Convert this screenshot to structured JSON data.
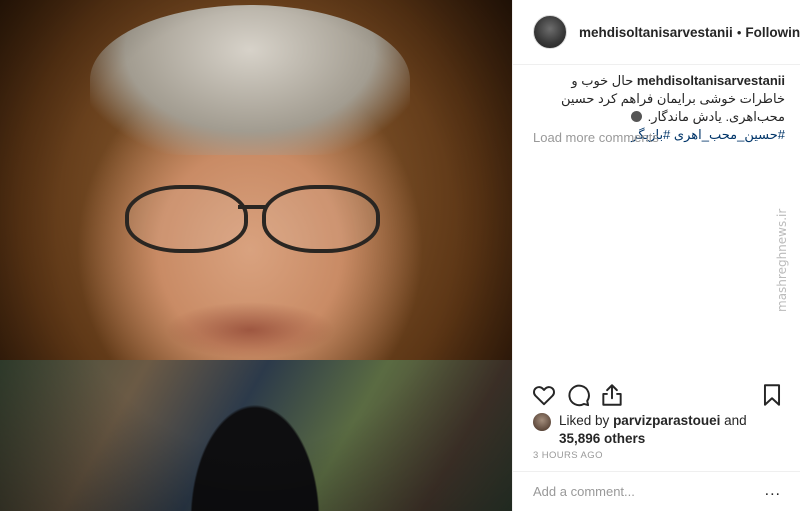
{
  "post": {
    "username": "mehdisoltanisarvestanii",
    "separator": "•",
    "follow_state": "Following"
  },
  "caption": {
    "username": "mehdisoltanisarvestanii",
    "text_1": "حال خوب و خاطرات خوشی برایمان فراهم کرد حسین محب‌اهری. یادش ماندگار.",
    "hashtag_1": "#حسین_محب_اهری",
    "hashtag_2": "#بازیگر"
  },
  "comments": {
    "load_more": "Load more comments"
  },
  "likes": {
    "prefix": "Liked by",
    "liker": "parvizparastouei",
    "and": "and",
    "count": "35,896 others"
  },
  "timestamp": "3 HOURS AGO",
  "add_comment": {
    "placeholder": "Add a comment...",
    "more": "..."
  },
  "icons": {
    "like": "heart-icon",
    "comment": "comment-icon",
    "share": "share-icon",
    "save": "bookmark-icon"
  },
  "watermark": "mashreghnews.ir"
}
